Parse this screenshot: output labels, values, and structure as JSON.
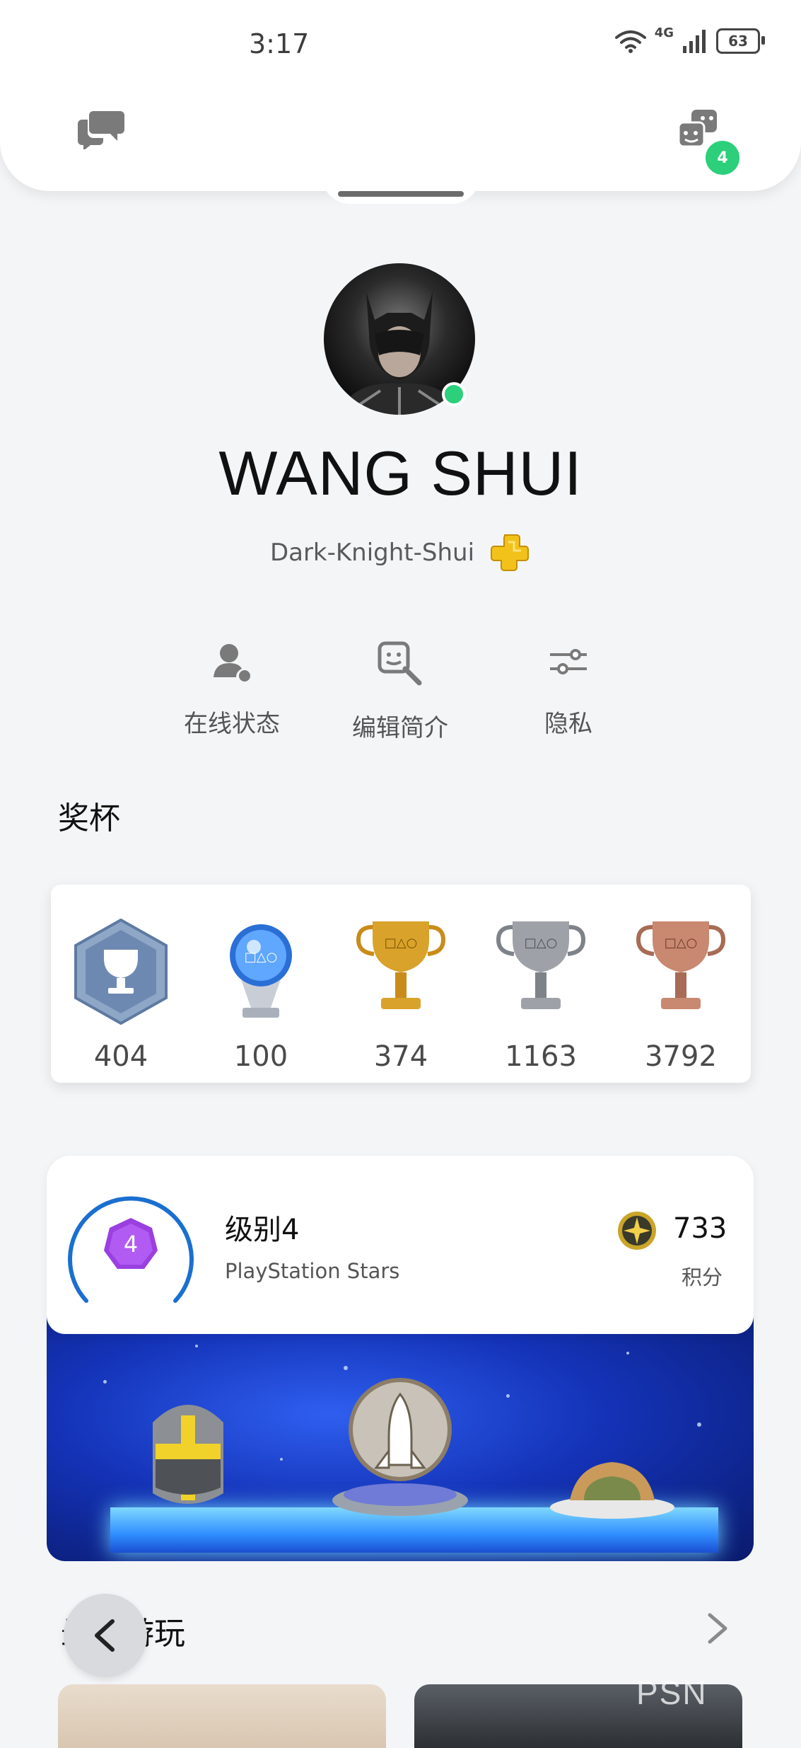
{
  "status_bar": {
    "time": "3:17",
    "network": "4G",
    "battery": "63"
  },
  "header": {
    "notification_count": "4"
  },
  "profile": {
    "name": "WANG SHUI",
    "online_id": "Dark-Knight-Shui"
  },
  "actions": [
    {
      "label": "在线状态",
      "icon": "user-status-icon"
    },
    {
      "label": "编辑简介",
      "icon": "edit-profile-icon"
    },
    {
      "label": "隐私",
      "icon": "sliders-icon"
    }
  ],
  "trophies": {
    "title": "奖杯",
    "items": [
      {
        "type": "level",
        "count": "404"
      },
      {
        "type": "platinum",
        "count": "100"
      },
      {
        "type": "gold",
        "count": "374"
      },
      {
        "type": "silver",
        "count": "1163"
      },
      {
        "type": "bronze",
        "count": "3792"
      }
    ]
  },
  "stars": {
    "level_number": "4",
    "level_title": "级别4",
    "subtitle": "PlayStation Stars",
    "points": "733",
    "points_label": "积分"
  },
  "recently_played": {
    "title": "最近游玩"
  },
  "watermark": "PSN"
}
